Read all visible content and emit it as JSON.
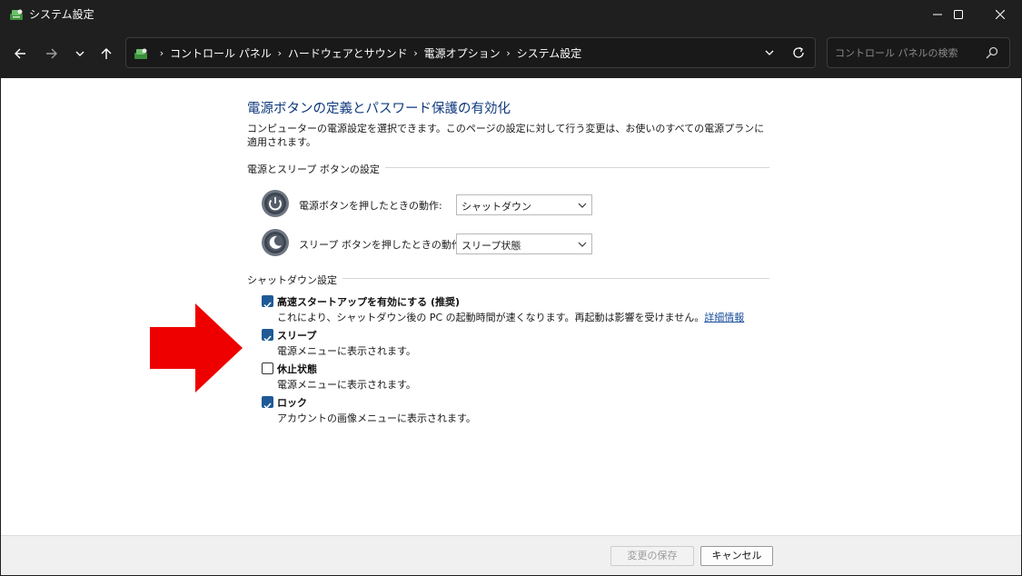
{
  "window": {
    "title": "システム設定",
    "icons": {
      "app": "control-panel-icon",
      "minimize": "minimize-icon",
      "maximize": "maximize-icon",
      "close": "close-icon"
    }
  },
  "nav": {
    "icons": [
      "back-arrow-icon",
      "forward-arrow-icon",
      "chevron-down-icon",
      "up-arrow-icon"
    ],
    "breadcrumbs": [
      "コントロール パネル",
      "ハードウェアとサウンド",
      "電源オプション",
      "システム設定"
    ],
    "search_placeholder": "コントロール パネルの検索"
  },
  "page": {
    "heading": "電源ボタンの定義とパスワード保護の有効化",
    "description": "コンピューターの電源設定を選択できます。このページの設定に対して行う変更は、お使いのすべての電源プランに適用されます。"
  },
  "power_buttons": {
    "group_label": "電源とスリープ ボタンの設定",
    "rows": [
      {
        "label": "電源ボタンを押したときの動作:",
        "value": "シャットダウン",
        "icon": "power-button-icon"
      },
      {
        "label": "スリープ ボタンを押したときの動作:",
        "value": "スリープ状態",
        "icon": "sleep-button-icon"
      }
    ]
  },
  "shutdown": {
    "group_label": "シャットダウン設定",
    "options": [
      {
        "title": "高速スタートアップを有効にする (推奨)",
        "desc": "これにより、シャットダウン後の PC の起動時間が速くなります。再起動は影響を受けません。",
        "link": "詳細情報",
        "checked": true
      },
      {
        "title": "スリープ",
        "desc": "電源メニューに表示されます。",
        "checked": true
      },
      {
        "title": "休止状態",
        "desc": "電源メニューに表示されます。",
        "checked": false
      },
      {
        "title": "ロック",
        "desc": "アカウントの画像メニューに表示されます。",
        "checked": true
      }
    ]
  },
  "footer": {
    "save_label": "変更の保存",
    "cancel_label": "キャンセル"
  },
  "colors": {
    "titlebar": "#1f1f1f",
    "heading": "#0f3a7d",
    "checkbox": "#1f5a96",
    "link": "#1a4f9c",
    "arrow": "#ee0000"
  }
}
